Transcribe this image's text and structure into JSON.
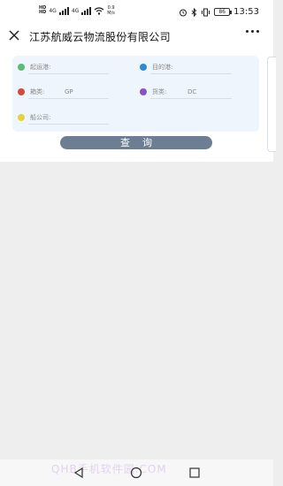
{
  "status_bar": {
    "sim1": "HD",
    "sim1_type": "4G",
    "sim2": "HD",
    "sim2_type": "4G",
    "net_speed": "0.9",
    "net_unit": "M/s",
    "battery": "86",
    "time": "13:53"
  },
  "header": {
    "title": "江苏航威云物流股份有限公司"
  },
  "form": {
    "origin_label": "起运港:",
    "origin_value": "",
    "dest_label": "目的港:",
    "dest_value": "",
    "box_type_label": "箱类:",
    "box_type_value": "GP",
    "cargo_type_label": "货类:",
    "cargo_type_value": "DC",
    "shipping_co_label": "船公司:",
    "shipping_co_value": "",
    "query_button": "查询"
  },
  "colors": {
    "origin_dot": "#5dbb74",
    "dest_dot": "#2f8ad6",
    "box_type_dot": "#d04a3d",
    "cargo_type_dot": "#8a52c6",
    "shipping_co_dot": "#e3d33a",
    "button": "#6e7e92"
  },
  "watermark": "QHB手机软件园.COM"
}
